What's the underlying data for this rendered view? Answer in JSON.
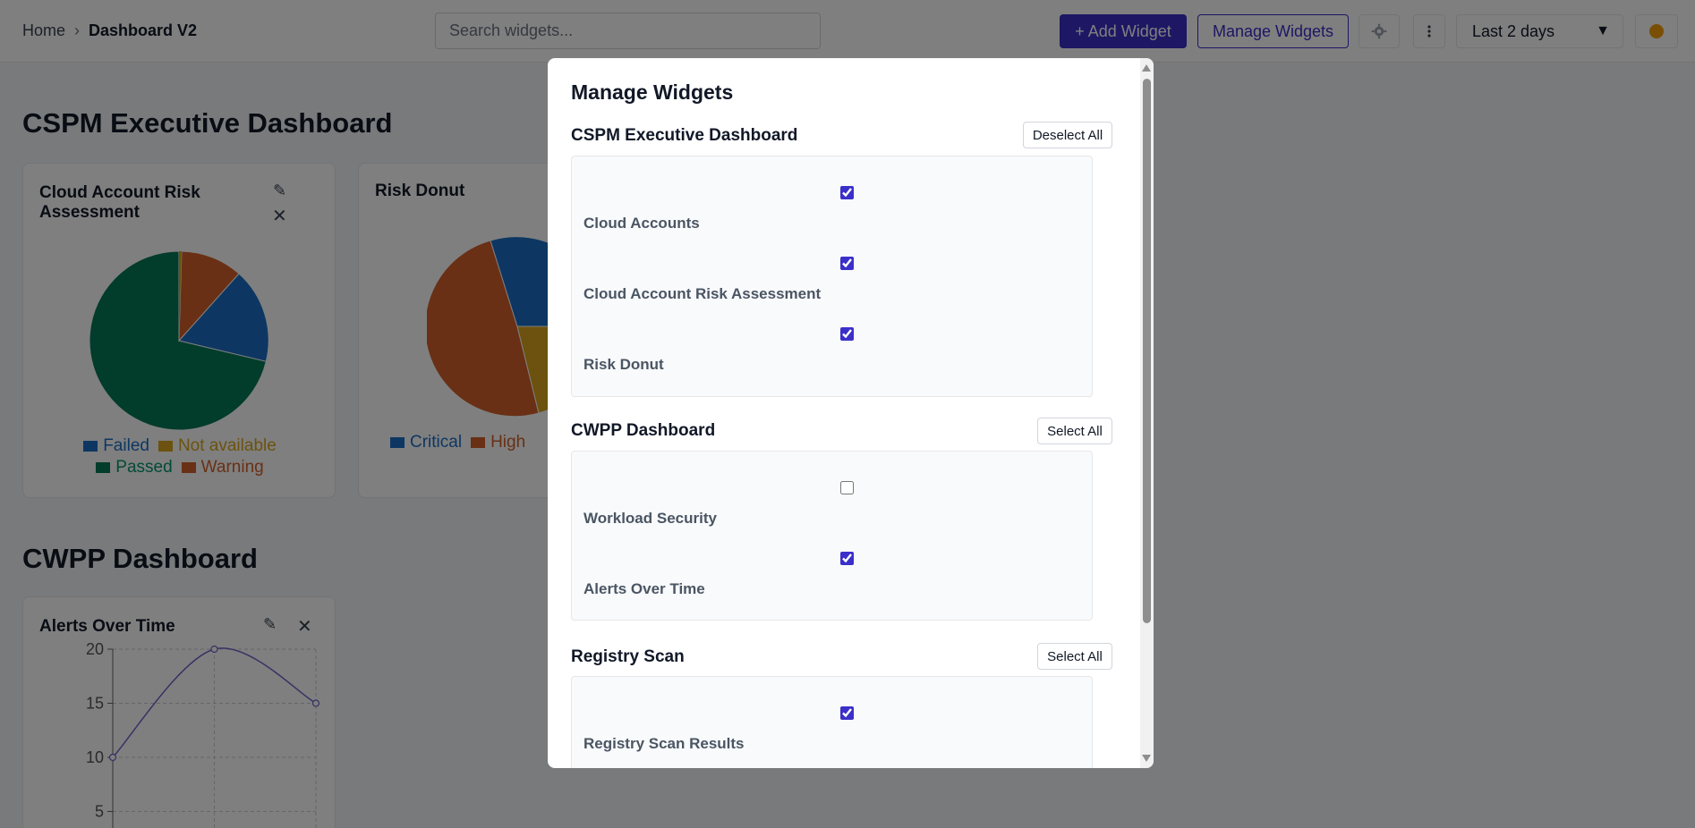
{
  "breadcrumb": {
    "home": "Home",
    "separator": "›",
    "current": "Dashboard V2"
  },
  "search": {
    "placeholder": "Search widgets..."
  },
  "toolbar": {
    "add_widget_label": "+ Add Widget",
    "manage_widgets_label": "Manage Widgets",
    "settings_icon": "gear-icon",
    "more_icon": "more-vertical-icon",
    "time_range": "Last 2 days",
    "theme_icon": "sun-icon"
  },
  "sections": [
    {
      "title": "CSPM Executive Dashboard",
      "widgets": [
        {
          "title": "Cloud Account Risk Assessment",
          "chart_data": {
            "type": "pie",
            "labels": [
              "Failed",
              "Not available",
              "Passed",
              "Warning"
            ],
            "values": [
              17,
              0,
              75,
              8
            ],
            "colors": [
              "#1a6fc4",
              "#d8a51d",
              "#047857",
              "#d2602b"
            ]
          }
        },
        {
          "title": "Risk Donut",
          "chart_data": {
            "type": "pie",
            "legend": [
              "Critical",
              "High"
            ],
            "colors": [
              "#1a6fc4",
              "#d2602b",
              "#d8a51d"
            ]
          }
        }
      ]
    },
    {
      "title": "CWPP Dashboard",
      "widgets": [
        {
          "title": "Alerts Over Time",
          "chart_data": {
            "type": "line",
            "x": [
              0,
              1,
              2
            ],
            "y": [
              10,
              20,
              15
            ],
            "yticks": [
              "20",
              "15",
              "10",
              "5"
            ],
            "ylim": [
              0,
              20
            ],
            "color": "#6d63c9",
            "grid": true
          }
        }
      ]
    }
  ],
  "modal": {
    "title": "Manage Widgets",
    "groups": [
      {
        "title": "CSPM Executive Dashboard",
        "action": "Deselect All",
        "items": [
          {
            "label": "Cloud Accounts",
            "checked": true
          },
          {
            "label": "Cloud Account Risk Assessment",
            "checked": true
          },
          {
            "label": "Risk Donut",
            "checked": true
          }
        ]
      },
      {
        "title": "CWPP Dashboard",
        "action": "Select All",
        "items": [
          {
            "label": "Workload Security",
            "checked": false
          },
          {
            "label": "Alerts Over Time",
            "checked": true
          }
        ]
      },
      {
        "title": "Registry Scan",
        "action": "Select All",
        "items": [
          {
            "label": "Registry Scan Results",
            "checked": true
          }
        ]
      }
    ]
  },
  "colors": {
    "accent": "#3b2fc9",
    "overlay": "rgba(0,0,0,0.5)"
  }
}
